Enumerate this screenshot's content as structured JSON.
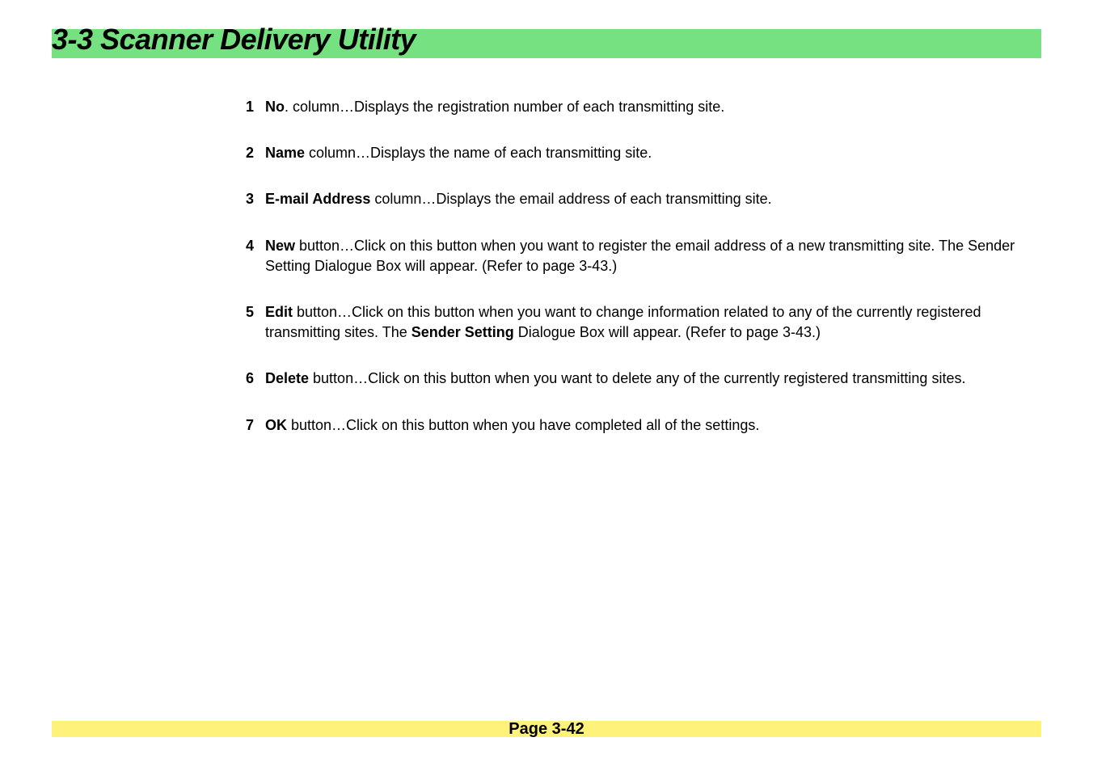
{
  "header": {
    "title": "3-3  Scanner Delivery Utility"
  },
  "items": [
    {
      "num": "1",
      "bold": "No",
      "rest": ". column…Displays the registration number of each transmitting site."
    },
    {
      "num": "2",
      "bold": "Name",
      "rest": " column…Displays the name of each transmitting site."
    },
    {
      "num": "3",
      "bold": "E-mail Address",
      "rest": " column…Displays the email address of each transmitting site."
    },
    {
      "num": "4",
      "bold": "New",
      "rest": " button…Click on this button when you want to register the email address of a new transmitting site. The Sender Setting Dialogue Box will appear. (Refer to page 3-43.)"
    },
    {
      "num": "5",
      "bold": "Edit",
      "rest_before": " button…Click on this button when you want to change information related to any of the currently registered transmitting sites. The ",
      "bold2": "Sender Setting",
      "rest_after": " Dialogue Box will appear. (Refer to page 3-43.)"
    },
    {
      "num": "6",
      "bold": "Delete",
      "rest": " button…Click on this button when you want to delete any of the currently registered transmitting sites."
    },
    {
      "num": "7",
      "bold": "OK",
      "rest": " button…Click on this button when you have completed all of the settings."
    }
  ],
  "footer": {
    "page": "Page 3-42"
  }
}
